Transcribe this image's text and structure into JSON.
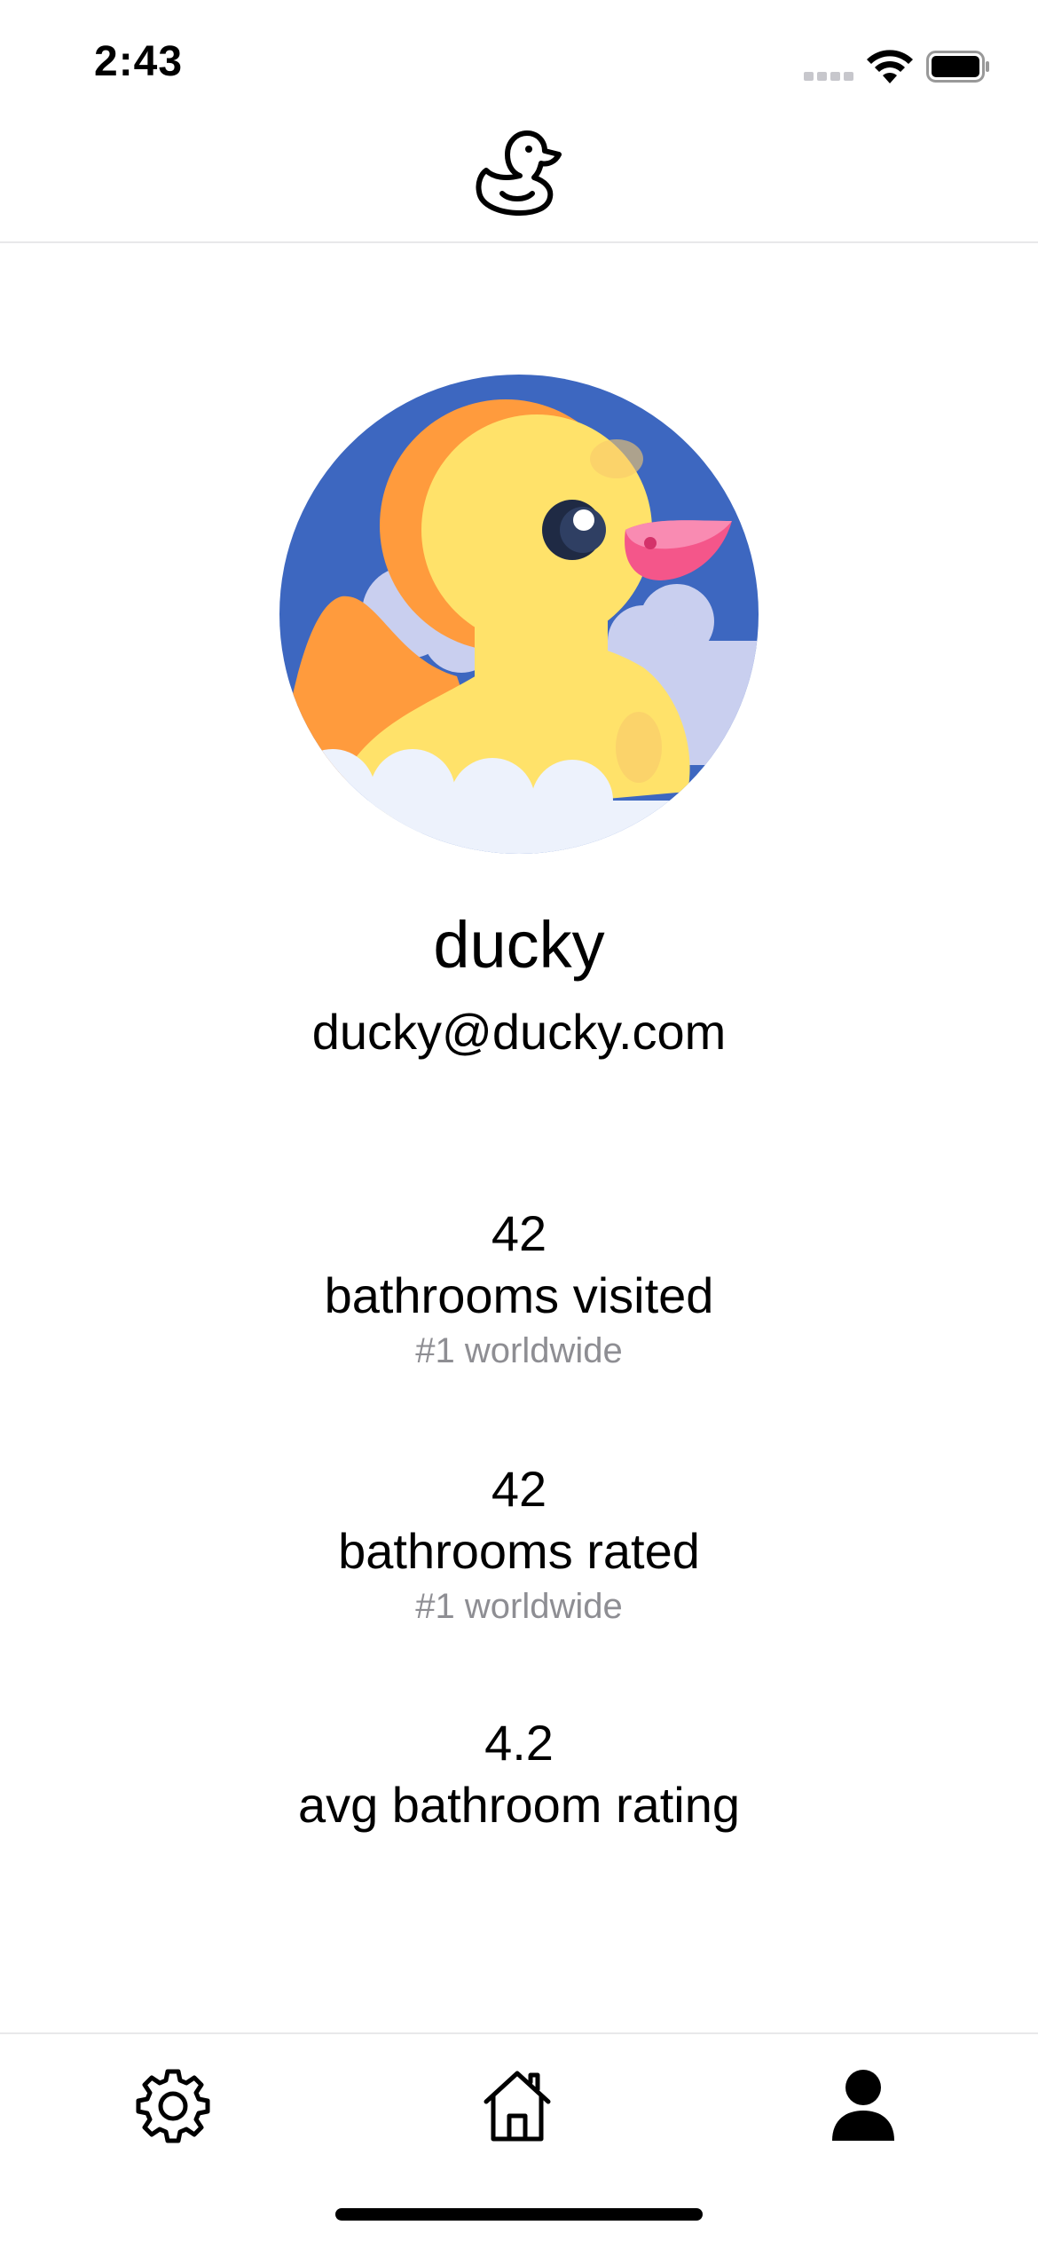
{
  "status_bar": {
    "time": "2:43"
  },
  "header": {
    "logo_icon": "duck-outline-icon"
  },
  "profile": {
    "avatar_icon": "rubber-duck-avatar",
    "name": "ducky",
    "email": "ducky@ducky.com"
  },
  "stats": [
    {
      "value": "42",
      "label": "bathrooms visited",
      "rank": "#1 worldwide"
    },
    {
      "value": "42",
      "label": "bathrooms rated",
      "rank": "#1 worldwide"
    },
    {
      "value": "4.2",
      "label": "avg bathroom rating"
    }
  ],
  "tab_bar": {
    "tabs": [
      {
        "name": "settings",
        "icon": "gear-icon"
      },
      {
        "name": "home",
        "icon": "house-icon"
      },
      {
        "name": "profile",
        "icon": "person-icon",
        "active": true
      }
    ]
  },
  "colors": {
    "avatar_bg": "#3d67c0",
    "duck_yellow": "#ffe26a",
    "duck_orange": "#ff9b3d",
    "beak_pink": "#f4568a",
    "cloud": "#c9cfef",
    "foam": "#edf2fc",
    "secondary_text": "#8e8e93",
    "divider": "#e8e8ea"
  }
}
